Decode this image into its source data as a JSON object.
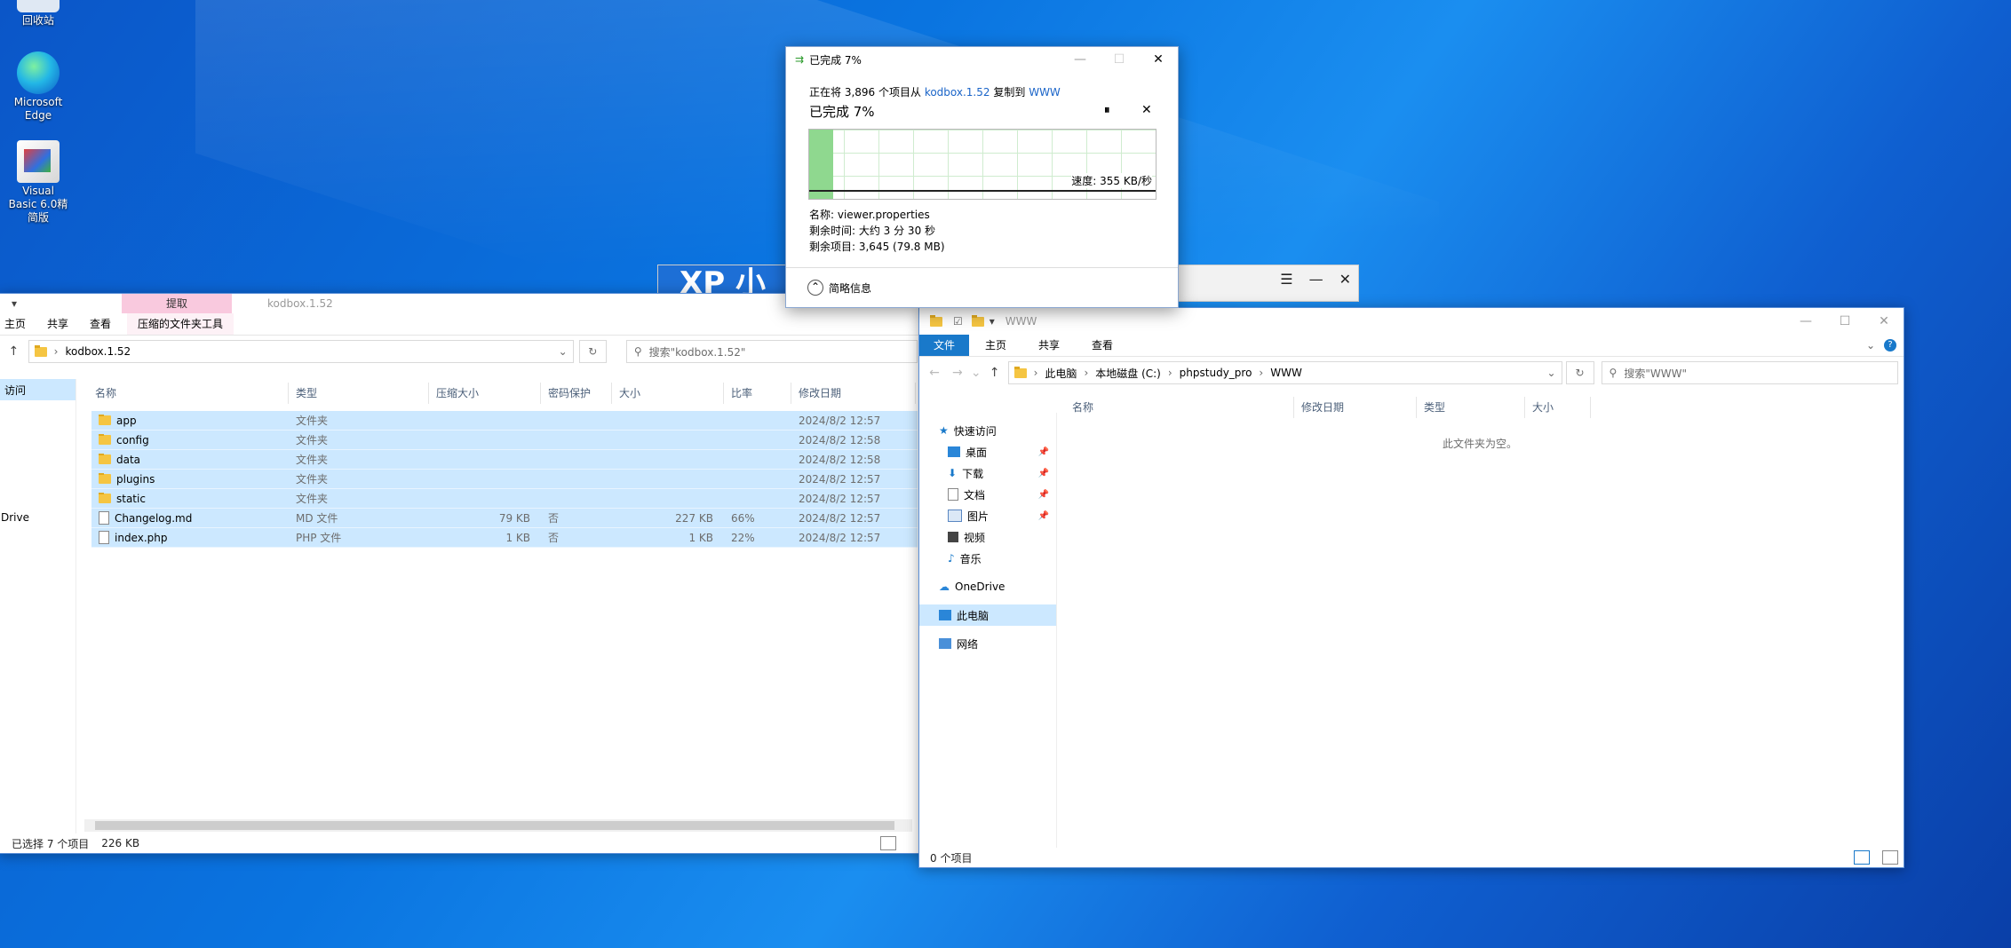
{
  "desktop": {
    "recycle_label": "回收站",
    "edge_label": "Microsoft Edge",
    "vb_label": "Visual Basic 6.0精简版"
  },
  "background_text": "XP 小",
  "left_explorer": {
    "title": "kodbox.1.52",
    "context_tab": "提取",
    "tabs": [
      "主页",
      "共享",
      "查看",
      "压缩的文件夹工具"
    ],
    "address": "kodbox.1.52",
    "search_placeholder": "搜索\"kodbox.1.52\"",
    "columns": [
      "名称",
      "类型",
      "压缩大小",
      "密码保护",
      "大小",
      "比率",
      "修改日期"
    ],
    "rows": [
      {
        "icon": "folder",
        "name": "app",
        "type": "文件夹",
        "csize": "",
        "pwd": "",
        "size": "",
        "ratio": "",
        "date": "2024/8/2 12:57"
      },
      {
        "icon": "folder",
        "name": "config",
        "type": "文件夹",
        "csize": "",
        "pwd": "",
        "size": "",
        "ratio": "",
        "date": "2024/8/2 12:58"
      },
      {
        "icon": "folder",
        "name": "data",
        "type": "文件夹",
        "csize": "",
        "pwd": "",
        "size": "",
        "ratio": "",
        "date": "2024/8/2 12:58"
      },
      {
        "icon": "folder",
        "name": "plugins",
        "type": "文件夹",
        "csize": "",
        "pwd": "",
        "size": "",
        "ratio": "",
        "date": "2024/8/2 12:57"
      },
      {
        "icon": "folder",
        "name": "static",
        "type": "文件夹",
        "csize": "",
        "pwd": "",
        "size": "",
        "ratio": "",
        "date": "2024/8/2 12:57"
      },
      {
        "icon": "file",
        "name": "Changelog.md",
        "type": "MD 文件",
        "csize": "79 KB",
        "pwd": "否",
        "size": "227 KB",
        "ratio": "66%",
        "date": "2024/8/2 12:57"
      },
      {
        "icon": "file",
        "name": "index.php",
        "type": "PHP 文件",
        "csize": "1 KB",
        "pwd": "否",
        "size": "1 KB",
        "ratio": "22%",
        "date": "2024/8/2 12:57"
      }
    ],
    "nav_partial": [
      "访问",
      "Drive"
    ],
    "status_selected": "已选择 7 个项目",
    "status_size": "226 KB"
  },
  "right_explorer": {
    "title": "WWW",
    "tabs": [
      "文件",
      "主页",
      "共享",
      "查看"
    ],
    "breadcrumb": [
      "此电脑",
      "本地磁盘 (C:)",
      "phpstudy_pro",
      "WWW"
    ],
    "search_placeholder": "搜索\"WWW\"",
    "columns": [
      "名称",
      "修改日期",
      "类型",
      "大小"
    ],
    "empty_text": "此文件夹为空。",
    "nav": {
      "quick_access": "快速访问",
      "items": [
        "桌面",
        "下载",
        "文档",
        "图片",
        "视频",
        "音乐"
      ],
      "onedrive": "OneDrive",
      "this_pc": "此电脑",
      "network": "网络"
    },
    "status": "0 个项目"
  },
  "progress_dialog": {
    "title": "已完成 7%",
    "desc_prefix": "正在将 3,896 个项目从",
    "source": "kodbox.1.52",
    "desc_middle": "复制到",
    "dest": "WWW",
    "heading": "已完成 7%",
    "progress": 0.07,
    "speed": "速度: 355 KB/秒",
    "name_line": "名称: viewer.properties",
    "time_line": "剩余时间: 大约 3 分 30 秒",
    "items_line": "剩余项目: 3,645 (79.8 MB)",
    "more_info": "简略信息"
  },
  "behind_window_controls": [
    "☰",
    "—",
    "✕"
  ],
  "colors": {
    "accent": "#1979ca",
    "selection": "#cce8ff",
    "progress_green": "#8fd88f"
  }
}
